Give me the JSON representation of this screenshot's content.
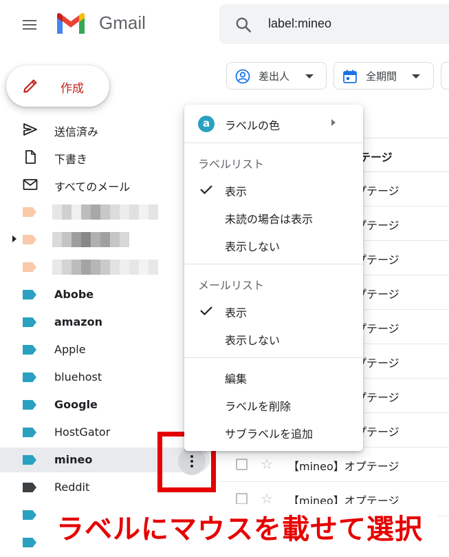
{
  "header": {
    "brand": "Gmail",
    "search_query": "label:mineo"
  },
  "compose": {
    "label": "作成"
  },
  "sidebar": {
    "items": [
      {
        "label": "送信済み",
        "bold": false
      },
      {
        "label": "下書き",
        "bold": false
      },
      {
        "label": "すべてのメール",
        "bold": false
      },
      {
        "label": "Abobe",
        "bold": true
      },
      {
        "label": "amazon",
        "bold": true
      },
      {
        "label": "Apple",
        "bold": false
      },
      {
        "label": "bluehost",
        "bold": false
      },
      {
        "label": "Google",
        "bold": true
      },
      {
        "label": "HostGator",
        "bold": false
      },
      {
        "label": "mineo",
        "bold": true
      },
      {
        "label": "Reddit",
        "bold": false
      }
    ],
    "colors": {
      "peach": "#f9c9aa",
      "teal": "#2aa1c0",
      "dark": "#3c4043"
    }
  },
  "filters": {
    "sender": "差出人",
    "period": "全期間"
  },
  "email_list": {
    "header_label": "オプテージ",
    "row_text": "オプテージ",
    "full_rows": [
      "【mineo】オプテージ",
      "【mineo】オプテージ"
    ]
  },
  "context_menu": {
    "color_badge": "a",
    "label_color": "ラベルの色",
    "label_list": {
      "heading": "ラベルリスト",
      "show": "表示",
      "show_if_unread": "未読の場合は表示",
      "hide": "表示しない"
    },
    "mail_list": {
      "heading": "メールリスト",
      "show": "表示",
      "hide": "表示しない"
    },
    "edit": "編集",
    "delete_label": "ラベルを削除",
    "add_sublabel": "サブラベルを追加"
  },
  "caption": "ラベルにマウスを載せて選択",
  "accent_colors": {
    "highlight_red": "#e60000",
    "compose_red": "#c5221f",
    "label_badge": "#2aa1c0"
  }
}
